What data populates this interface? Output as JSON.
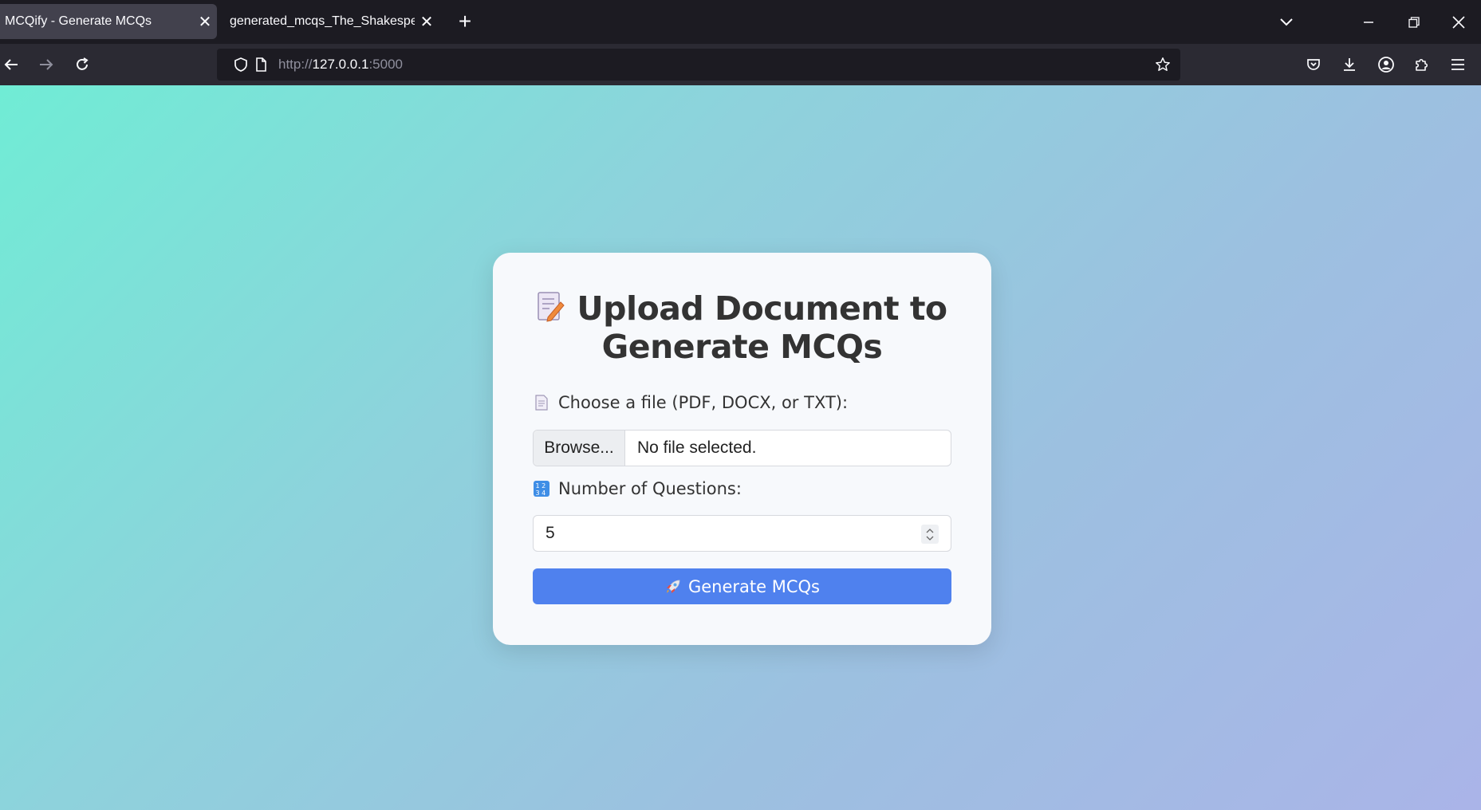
{
  "browser": {
    "tabs": [
      {
        "title": "MCQify - Generate MCQs",
        "active": true
      },
      {
        "title": "generated_mcqs_The_Shakespear_E",
        "active": false
      }
    ],
    "url_scheme": "http://",
    "url_host": "127.0.0.1",
    "url_port": ":5000"
  },
  "page": {
    "heading_line1": "Upload Document to",
    "heading_line2": "Generate MCQs",
    "file_label": "Choose a file (PDF, DOCX, or TXT):",
    "browse_label": "Browse...",
    "file_status": "No file selected.",
    "questions_label": "Number of Questions:",
    "questions_value": "5",
    "submit_label": "Generate MCQs"
  },
  "colors": {
    "gradient_start": "#70ecd5",
    "gradient_end": "#aab4e8",
    "button_blue": "#4f81ee"
  }
}
